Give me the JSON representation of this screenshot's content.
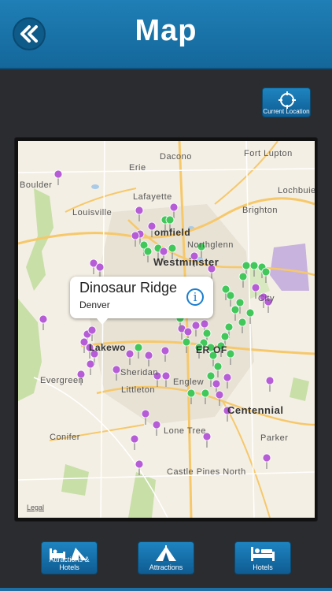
{
  "header": {
    "title": "Map",
    "back_icon": "double-chevron-left-icon"
  },
  "toolbar": {
    "current_location_label": "Current Location"
  },
  "map": {
    "places": {
      "boulder": "Boulder",
      "erie": "Erie",
      "dacono": "Dacono",
      "fort_lupton": "Fort Lupton",
      "lochbuie": "Lochbuie",
      "lafayette": "Lafayette",
      "louisville": "Louisville",
      "brighton": "Brighton",
      "broomfield": "omfield",
      "northglenn": "Northglenn",
      "westminster": "Westminster",
      "city": "City",
      "lakewood": "Lakewo",
      "denver_short": "ER",
      "sheridan": "Sheridan",
      "evergreen": "Evergreen",
      "littleton": "Littleton",
      "englewood": "Englew",
      "centennial": "Centennial",
      "lone_tree": "Lone Tree",
      "conifer": "Conifer",
      "parker": "Parker",
      "castle_pines_north": "Castle Pines North",
      "aurora_part": "OF"
    },
    "legal_label": "Legal",
    "callout": {
      "title": "Dinosaur Ridge",
      "subtitle": "Denver"
    }
  },
  "tabs": [
    {
      "label": "Attractions & Hotels",
      "icon": "attractions-hotels-icon"
    },
    {
      "label": "Attractions",
      "icon": "tent-icon"
    },
    {
      "label": "Hotels",
      "icon": "bed-icon"
    }
  ],
  "colors": {
    "header": "#1a74ad",
    "pin_purple": "#b65cd6",
    "pin_green": "#42c85a",
    "background": "#2b2c30"
  }
}
